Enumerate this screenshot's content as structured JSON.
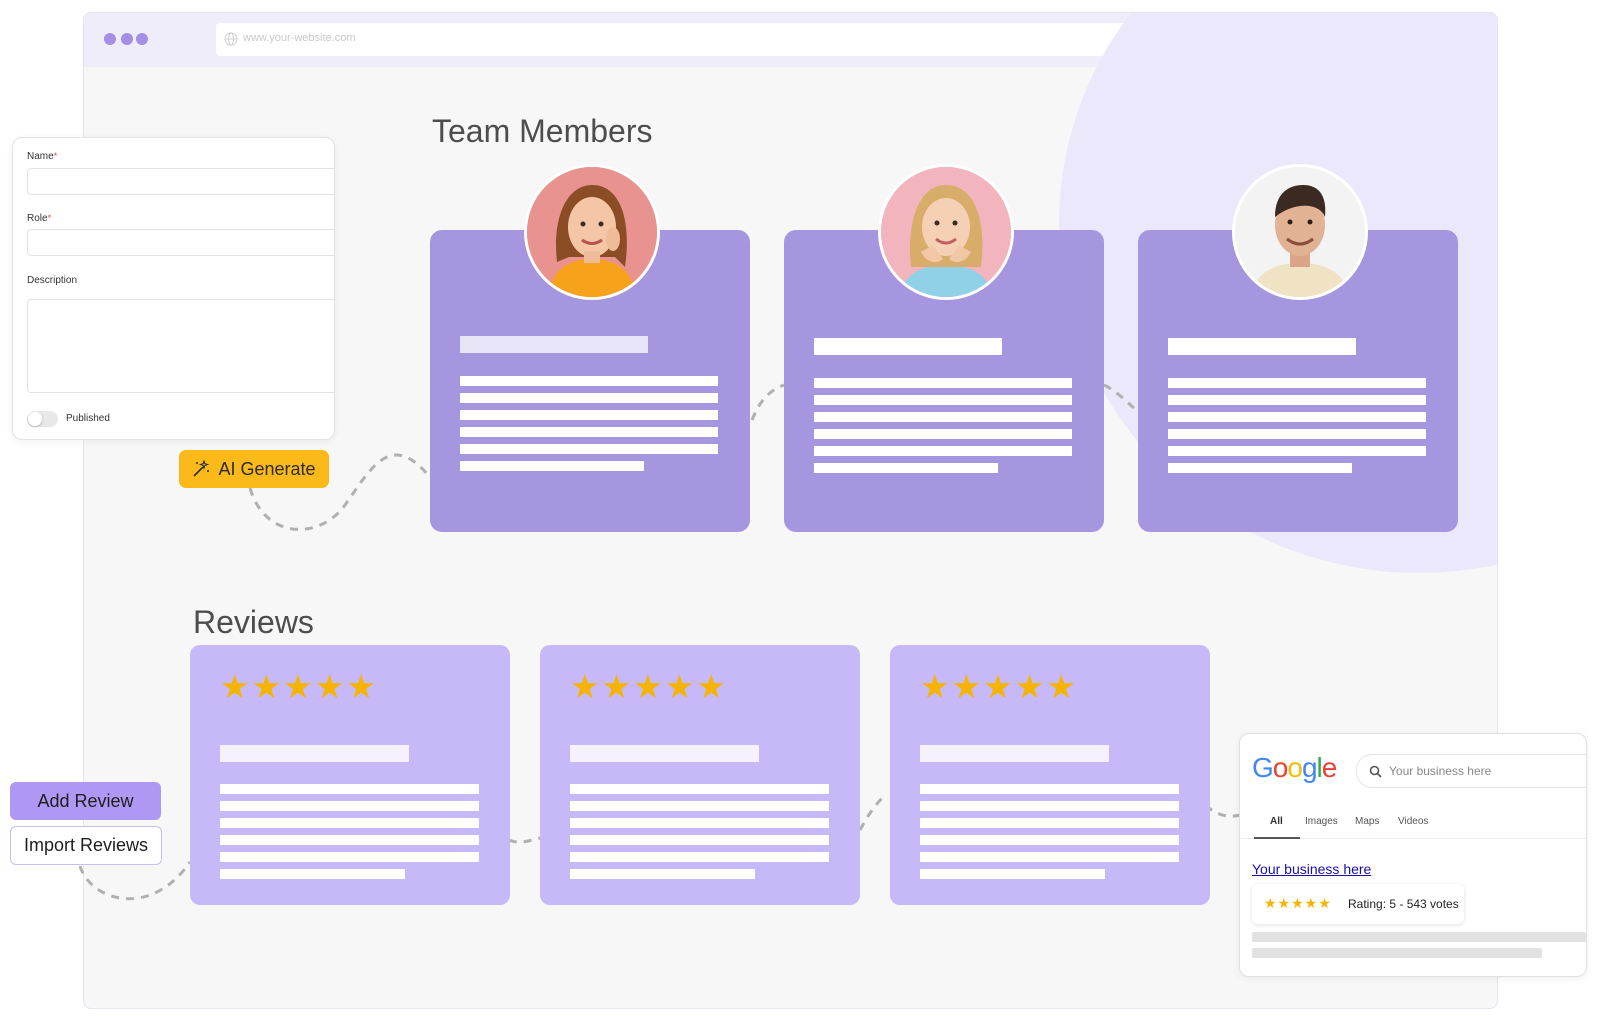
{
  "browser": {
    "url": "www.your-website.com",
    "window_dots": [
      "window-dot-1",
      "window-dot-2",
      "window-dot-3"
    ],
    "accent_color": "#a38fe3"
  },
  "team": {
    "heading": "Team Members",
    "card_color": "#a695df",
    "members": [
      {
        "avatar": "woman-orange-top-portrait"
      },
      {
        "avatar": "girl-pink-background-portrait"
      },
      {
        "avatar": "man-white-background-portrait"
      }
    ]
  },
  "reviews": {
    "heading": "Reviews",
    "card_color": "#c7b9f7",
    "cards": [
      {
        "stars": "★★★★★"
      },
      {
        "stars": "★★★★★"
      },
      {
        "stars": "★★★★★"
      }
    ]
  },
  "form": {
    "name_label": "Name",
    "role_label": "Role",
    "description_label": "Description",
    "required_mark": "*",
    "published_label": "Published",
    "published": false
  },
  "actions": {
    "ai_generate": "AI Generate",
    "ai_generate_color": "#fcba1a",
    "add_review": "Add Review",
    "import_reviews": "Import Reviews"
  },
  "google": {
    "logo": "Google",
    "search_placeholder": "Your business here",
    "tabs": [
      "All",
      "Images",
      "Maps",
      "Videos"
    ],
    "active_tab": "All",
    "result_title": "Your business here",
    "result_stars": "★★★★★",
    "rating_text": "Rating: 5 - 543 votes"
  }
}
